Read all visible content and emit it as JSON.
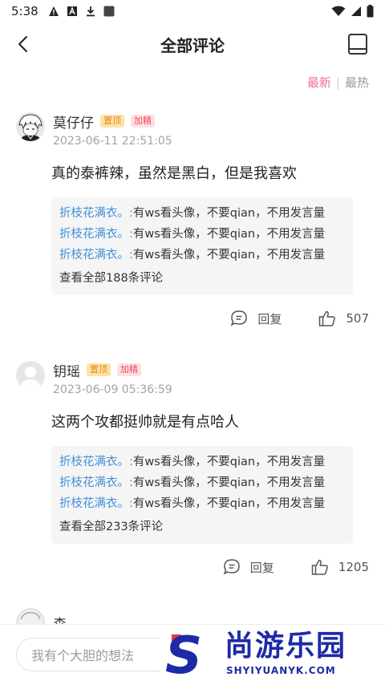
{
  "status_bar": {
    "time": "5:38"
  },
  "nav": {
    "title": "全部评论"
  },
  "sort": {
    "active": "最新",
    "separator": "|",
    "inactive": "最热"
  },
  "comments": [
    {
      "name": "莫仔仔",
      "badge_top": "置顶",
      "badge_fine": "加精",
      "time": "2023-06-11 22:51:05",
      "text": "真的泰裤辣，虽然是黑白，但是我喜欢",
      "replies": [
        {
          "user": "折枝花满衣。:",
          "text": "有ws看头像，不要qian，不用发言量"
        },
        {
          "user": "折枝花满衣。:",
          "text": "有ws看头像，不要qian，不用发言量"
        },
        {
          "user": "折枝花满衣。:",
          "text": "有ws看头像，不要qian，不用发言量"
        }
      ],
      "view_all": "查看全部188条评论",
      "reply_label": "回复",
      "likes": "507"
    },
    {
      "name": "钥瑶",
      "badge_top": "置顶",
      "badge_fine": "加精",
      "time": "2023-06-09 05:36:59",
      "text": "这两个攻都挺帅就是有点哈人",
      "replies": [
        {
          "user": "折枝花满衣。:",
          "text": "有ws看头像，不要qian，不用发言量"
        },
        {
          "user": "折枝花满衣。:",
          "text": "有ws看头像，不要qian，不用发言量"
        },
        {
          "user": "折枝花满衣。:",
          "text": "有ws看头像，不要qian，不用发言量"
        }
      ],
      "view_all": "查看全部233条评论",
      "reply_label": "回复",
      "likes": "1205"
    }
  ],
  "peek_comment": {
    "name": "森"
  },
  "bottom": {
    "input_placeholder": "我有个大胆的想法"
  },
  "watermark": {
    "letter": "S",
    "name": "尚游乐园",
    "url": "SHYIYUANYK.COM"
  },
  "colors": {
    "accent": "#f0728f",
    "reply_user": "#3f8fd9",
    "badge_top": "#e58a1c",
    "badge_fine": "#f04a5e",
    "watermark": "#1d2aa8"
  },
  "icons": [
    "back-arrow-icon",
    "book-icon",
    "comment-icon",
    "thumbs-up-icon"
  ]
}
